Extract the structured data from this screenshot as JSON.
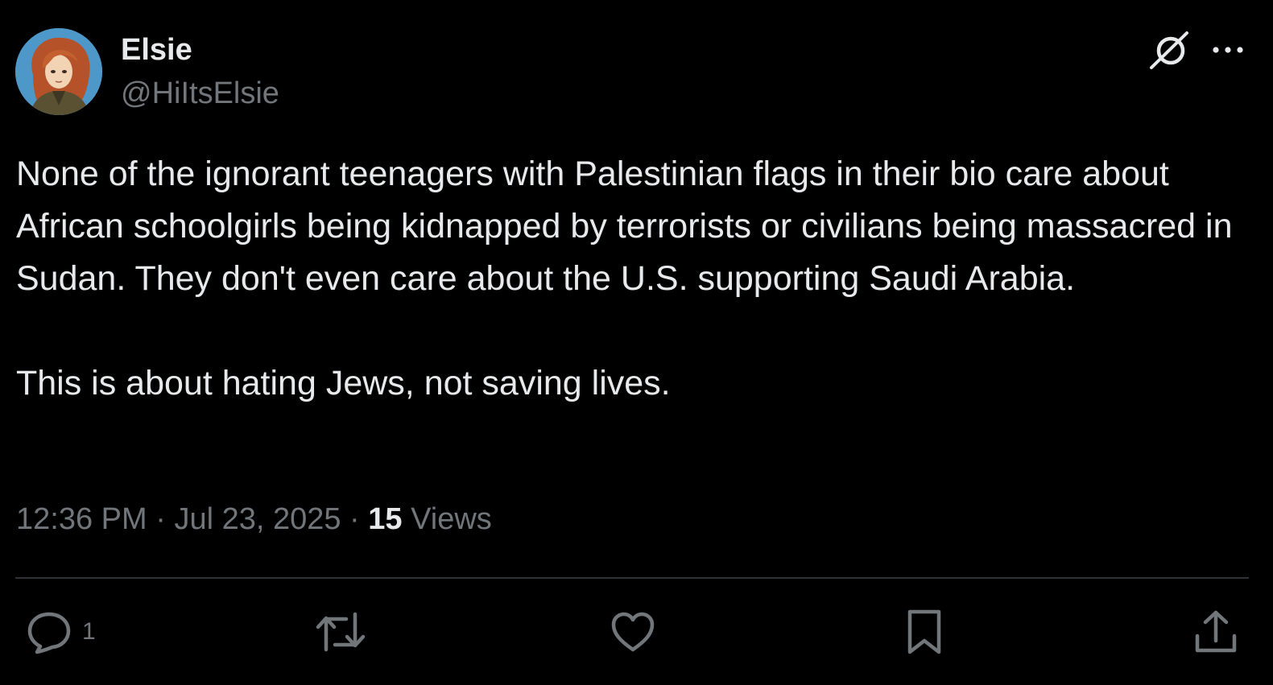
{
  "author": {
    "display_name": "Elsie",
    "handle": "@HiItsElsie"
  },
  "tweet": {
    "text": "None of the ignorant teenagers with Palestinian flags in their bio care about African schoolgirls being kidnapped by terrorists or civilians being massacred in Sudan. They don't even care about the U.S. supporting Saudi Arabia.\n\nThis is about hating Jews, not saving lives.",
    "time": "12:36 PM",
    "date": "Jul 23, 2025",
    "separator": " · ",
    "views_count": "15",
    "views_label": " Views"
  },
  "actions": {
    "reply_count": "1",
    "items": [
      "reply-icon",
      "retweet-icon",
      "like-icon",
      "bookmark-icon",
      "share-icon"
    ]
  },
  "header_icons": [
    "grok-icon",
    "more-icon"
  ],
  "colors": {
    "background": "#000000",
    "primary_text": "#e7e9ea",
    "secondary_text": "#71767b",
    "divider": "#2f3336"
  }
}
